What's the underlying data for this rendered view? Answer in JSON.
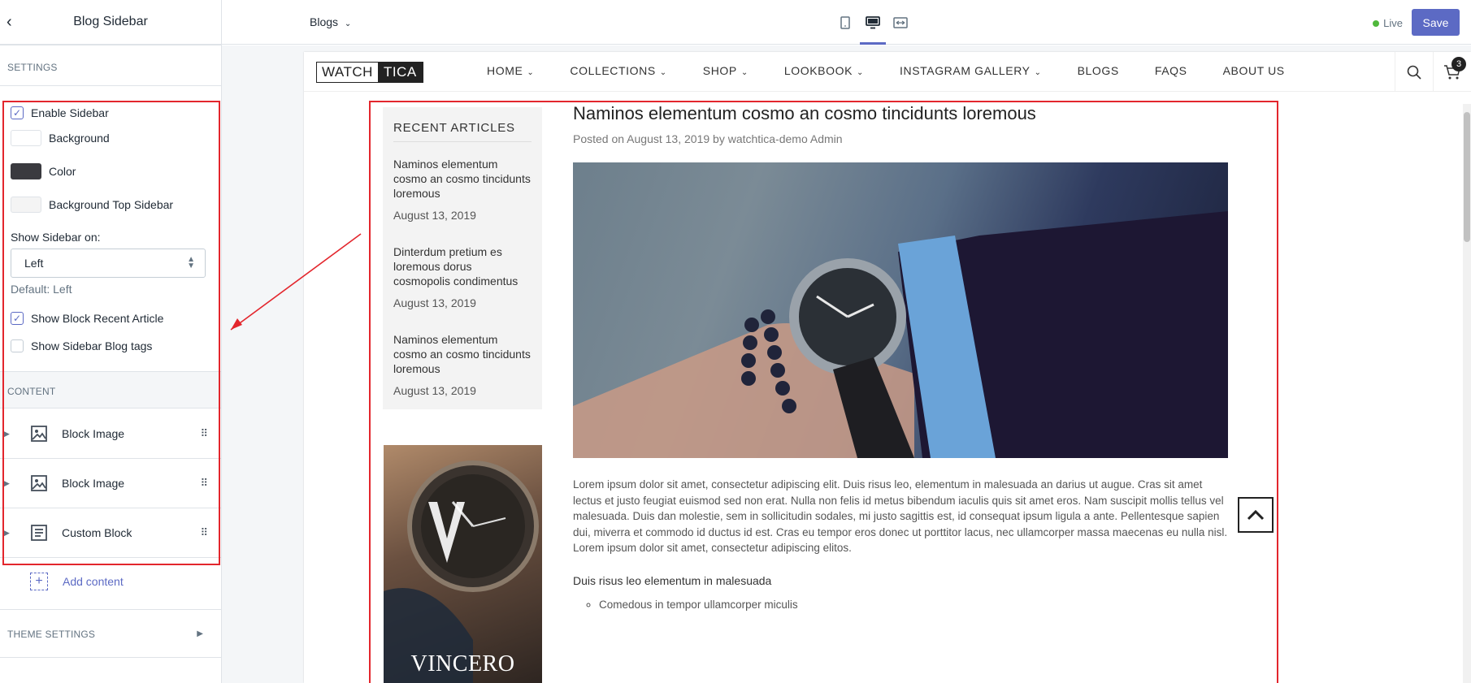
{
  "editor": {
    "title": "Blog Sidebar",
    "settings_label": "SETTINGS",
    "enable_sidebar": "Enable Sidebar",
    "background": "Background",
    "color": "Color",
    "background_top_sidebar": "Background Top Sidebar",
    "show_sidebar_on_label": "Show Sidebar on:",
    "show_sidebar_on_value": "Left",
    "default_help": "Default: Left",
    "show_block_recent": "Show Block Recent Article",
    "show_sidebar_tags": "Show Sidebar Blog tags",
    "content_label": "CONTENT",
    "blocks": [
      {
        "label": "Block Image",
        "icon": "image-icon"
      },
      {
        "label": "Block Image",
        "icon": "image-icon"
      },
      {
        "label": "Custom Block",
        "icon": "text-block-icon"
      }
    ],
    "add_content": "Add content",
    "theme_settings": "THEME SETTINGS",
    "colors": {
      "color_swatch": "#3a3a3f",
      "bg_top_swatch": "#f4f4f4"
    }
  },
  "topbar": {
    "page_select": "Blogs",
    "live": "Live",
    "save": "Save"
  },
  "store": {
    "logo_left": "WATCH",
    "logo_right": "TICA",
    "nav": [
      "HOME",
      "COLLECTIONS",
      "SHOP",
      "LOOKBOOK",
      "INSTAGRAM GALLERY",
      "BLOGS",
      "FAQS",
      "ABOUT US"
    ],
    "cart_count": "3",
    "sidebar": {
      "title": "RECENT ARTICLES",
      "articles": [
        {
          "title": "Naminos elementum cosmo an cosmo tincidunts loremous",
          "date": "August 13, 2019"
        },
        {
          "title": "Dinterdum pretium es loremous dorus cosmopolis condimentus",
          "date": "August 13, 2019"
        },
        {
          "title": "Naminos elementum cosmo an cosmo tincidunts loremous",
          "date": "August 13, 2019"
        }
      ],
      "promo_text": "VINCERO"
    },
    "article": {
      "title": "Naminos elementum cosmo an cosmo tincidunts loremous",
      "meta": "Posted on August 13, 2019 by watchtica-demo Admin",
      "body": "Lorem ipsum dolor sit amet, consectetur adipiscing elit. Duis risus leo, elementum in malesuada an darius ut augue. Cras sit amet lectus et justo feugiat euismod sed non erat. Nulla non felis id metus bibendum iaculis quis sit amet eros. Nam suscipit mollis tellus vel malesuada. Duis dan molestie, sem in sollicitudin sodales, mi justo sagittis est, id consequat ipsum ligula a ante. Pellentesque sapien dui, miverra et commodo id ductus id est. Cras eu tempor eros donec ut porttitor lacus, nec ullamcorper massa maecenas eu nulla nisl. Lorem ipsum dolor sit amet, consectetur adipiscing elitos.",
      "subheading": "Duis risus leo elementum in malesuada",
      "list_first": "Comedous in tempor ullamcorper miculis"
    }
  }
}
